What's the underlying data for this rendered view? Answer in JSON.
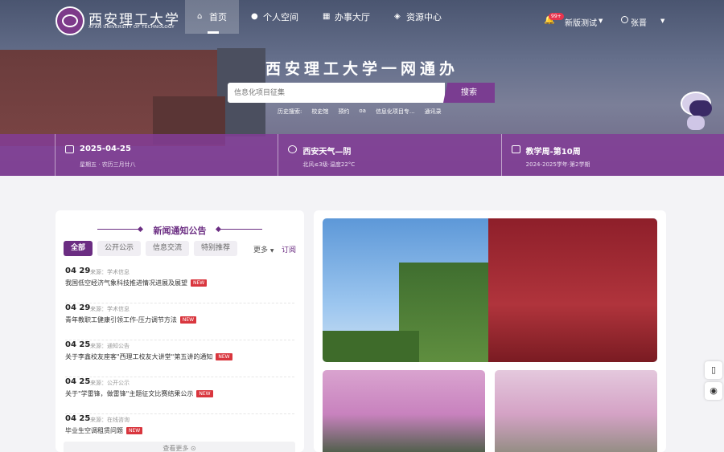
{
  "brand": {
    "name_cn": "西安理工大学",
    "name_en": "XI'AN UNIVERSITY OF TECHNOLOGY"
  },
  "nav": [
    {
      "label": "首页",
      "icon": "home-icon",
      "active": true
    },
    {
      "label": "个人空间",
      "icon": "user-icon",
      "active": false
    },
    {
      "label": "办事大厅",
      "icon": "grid-icon",
      "active": false
    },
    {
      "label": "资源中心",
      "icon": "layers-icon",
      "active": false
    }
  ],
  "topright": {
    "badge": "99+",
    "beta_label": "新版测试",
    "user_name": "张晋"
  },
  "hero": {
    "title": "西安理工大学一网通办",
    "search_placeholder": "信息化项目征集",
    "search_button": "搜索",
    "history_label": "历史搜索:",
    "history": [
      "校史馆",
      "预约",
      "oa",
      "信息化项目专...",
      "通讯录"
    ]
  },
  "info": {
    "date": "2025-04-25",
    "weekday": "星期五",
    "lunar": "农历三月廿八",
    "weather_title": "西安天气—阴",
    "weather_detail": "北风≤3级·温度22°C",
    "week_title": "教学周-第10周",
    "semester": "2024-2025学年·第2学期"
  },
  "news": {
    "title": "新闻通知公告",
    "tabs": [
      "全部",
      "公开公示",
      "信息交流",
      "特别推荐"
    ],
    "more": "更多",
    "subscribe": "订阅",
    "items": [
      {
        "date": "04 29",
        "source": "来源：学术信息",
        "title": "我国低空经济气象科技推进情况进展及展望",
        "tag": "NEW"
      },
      {
        "date": "04 29",
        "source": "来源：学术信息",
        "title": "青年教职工健康引领工作-压力调节方法",
        "tag": "NEW"
      },
      {
        "date": "04 25",
        "source": "来源：通知公告",
        "title": "关于李鑫校友座客\"西理工校友大讲堂\"第五讲的通知",
        "tag": "NEW"
      },
      {
        "date": "04 25",
        "source": "来源：公开公示",
        "title": "关于\"学雷锋，做雷锋\"主题征文比赛结果公示",
        "tag": "NEW"
      },
      {
        "date": "04 25",
        "source": "来源：在线咨询",
        "title": "毕业生空调租赁问题",
        "tag": "NEW"
      }
    ],
    "view_more": "查看更多"
  }
}
